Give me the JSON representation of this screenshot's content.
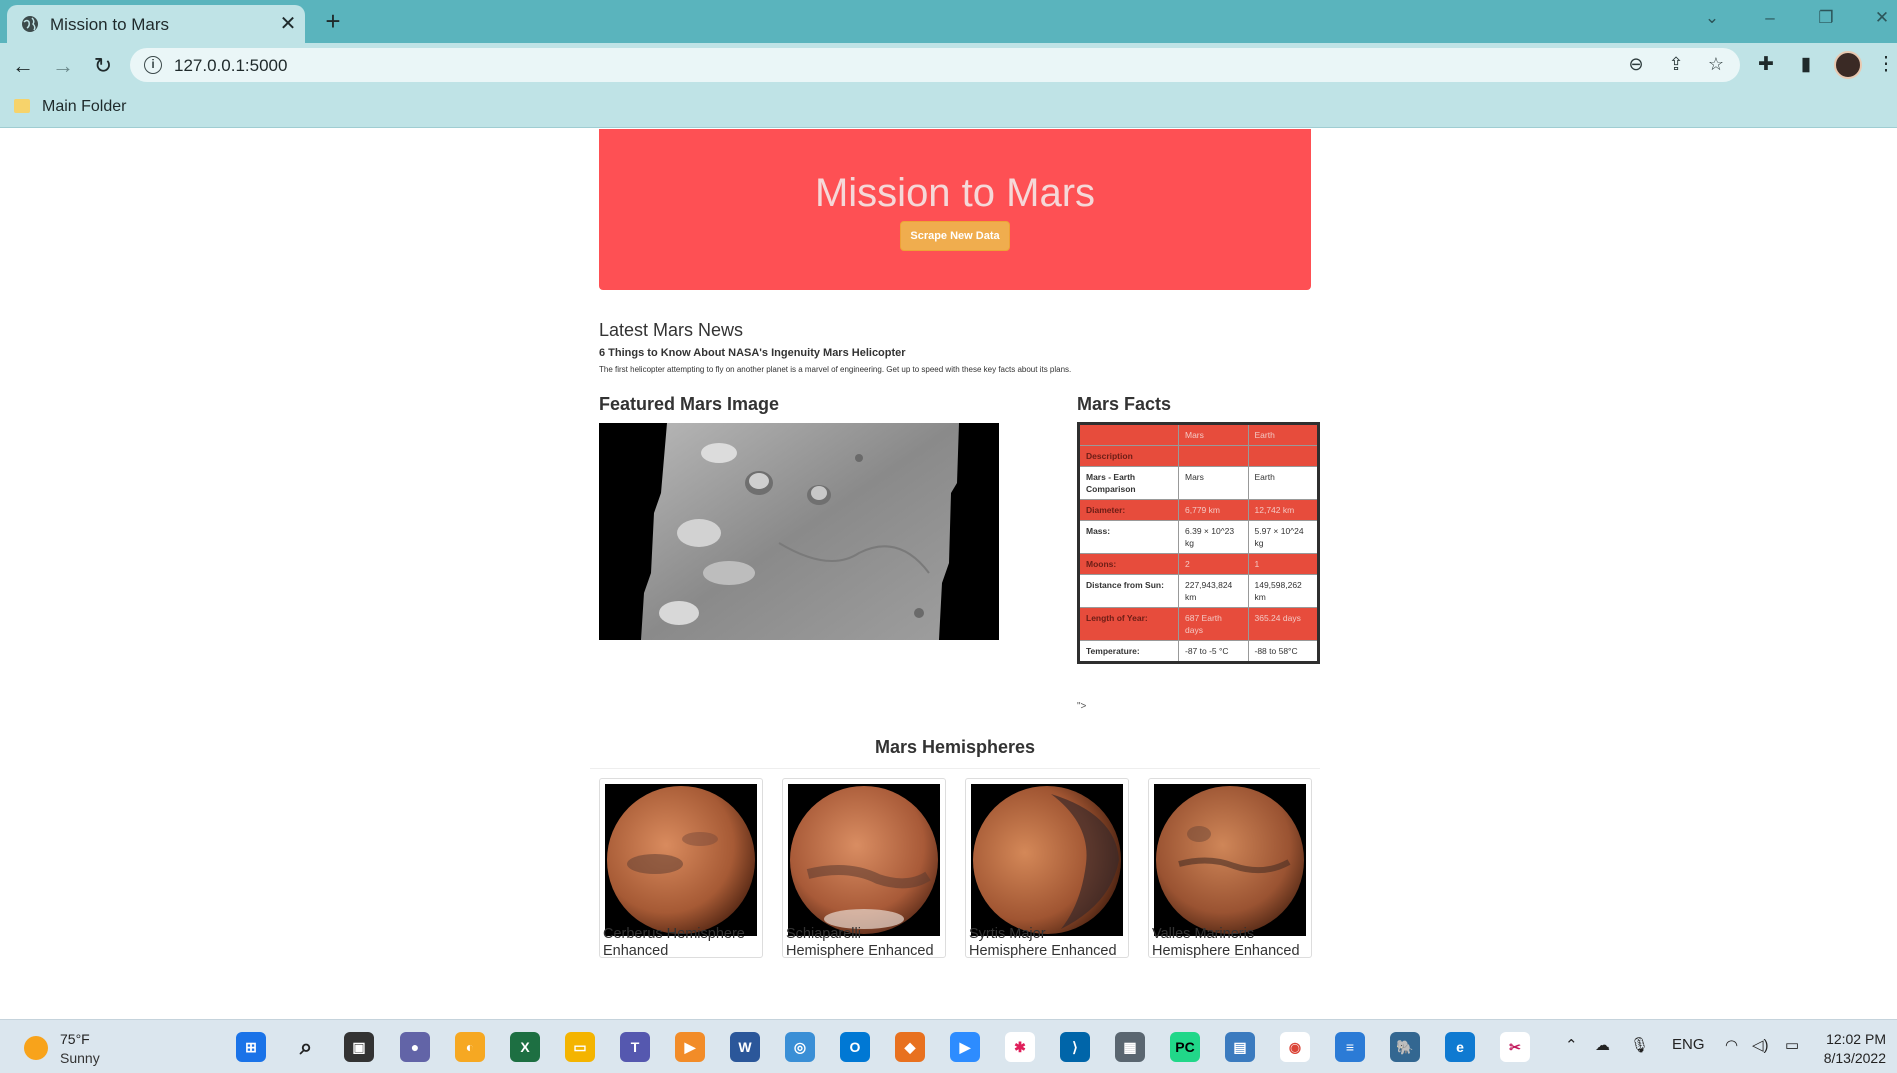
{
  "browser": {
    "tab_title": "Mission to Mars",
    "tab_close": "✕",
    "new_tab": "+",
    "url": "127.0.0.1:5000",
    "bookmark_folder": "Main Folder"
  },
  "header": {
    "title": "Mission to Mars",
    "scrape_button": "Scrape New Data"
  },
  "news": {
    "heading": "Latest Mars News",
    "title": "6 Things to Know About NASA's Ingenuity Mars Helicopter",
    "paragraph": "The first helicopter attempting to fly on another planet is a marvel of engineering. Get up to speed with these key facts about its plans."
  },
  "featured": {
    "heading": "Featured Mars Image"
  },
  "facts": {
    "heading": "Mars Facts",
    "columns": [
      "",
      "Mars",
      "Earth"
    ],
    "rows": [
      [
        "Description",
        "",
        ""
      ],
      [
        "Mars - Earth Comparison",
        "Mars",
        "Earth"
      ],
      [
        "Diameter:",
        "6,779 km",
        "12,742 km"
      ],
      [
        "Mass:",
        "6.39 × 10^23 kg",
        "5.97 × 10^24 kg"
      ],
      [
        "Moons:",
        "2",
        "1"
      ],
      [
        "Distance from Sun:",
        "227,943,824 km",
        "149,598,262 km"
      ],
      [
        "Length of Year:",
        "687 Earth days",
        "365.24 days"
      ],
      [
        "Temperature:",
        "-87 to -5 °C",
        "-88 to 58°C"
      ]
    ],
    "stray_text": "\">"
  },
  "hemispheres": {
    "heading": "Mars Hemispheres",
    "items": [
      {
        "title": "Cerberus Hemisphere Enhanced"
      },
      {
        "title": "Schiaparelli Hemisphere Enhanced"
      },
      {
        "title": "Syrtis Major Hemisphere Enhanced"
      },
      {
        "title": "Valles Marineris Hemisphere Enhanced"
      }
    ]
  },
  "taskbar": {
    "weather_temp": "75°F",
    "weather_condition": "Sunny",
    "language": "ENG",
    "time": "12:02 PM",
    "date": "8/13/2022"
  },
  "colors": {
    "jumbotron": "#fe5054",
    "button": "#f0ad4e",
    "table_red": "#e74c3c",
    "chrome": "#bfe3e6"
  }
}
